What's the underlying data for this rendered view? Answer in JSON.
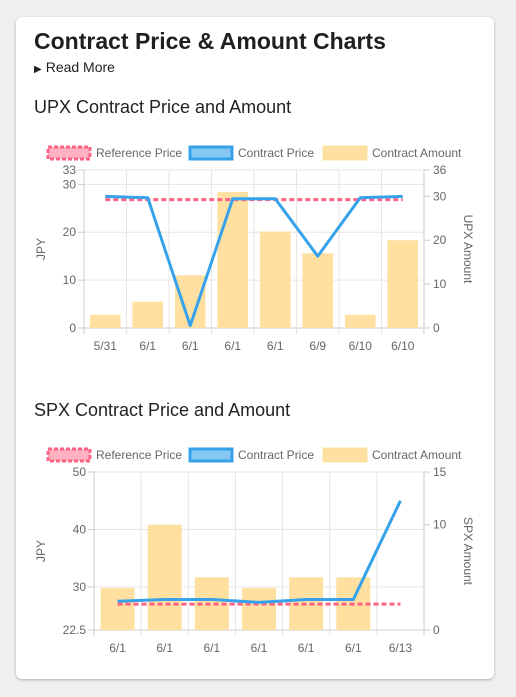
{
  "page": {
    "title": "Contract Price & Amount Charts",
    "read_more": "Read More",
    "read_more_icon": "triangle-right-icon"
  },
  "colors": {
    "reference": "#ff6384",
    "contract_price": "#36a2eb",
    "contract_amount": "#ffe0a0",
    "grid": "#e6e6e6",
    "text": "#666666"
  },
  "chart_data": [
    {
      "type": "bar",
      "title": "UPX Contract Price and Amount",
      "legend": [
        "Reference Price",
        "Contract Price",
        "Contract Amount"
      ],
      "legend_position": "top",
      "categories": [
        "5/31",
        "6/1",
        "6/1",
        "6/1",
        "6/1",
        "6/9",
        "6/10",
        "6/10"
      ],
      "ylabel_left": "JPY",
      "ylabel_right": "UPX Amount",
      "left_ticks": [
        0,
        10,
        20,
        30,
        33
      ],
      "right_ticks": [
        0,
        10,
        20,
        30,
        36
      ],
      "ylim_left": [
        0,
        33
      ],
      "ylim_right": [
        0,
        36
      ],
      "grid": true,
      "series": [
        {
          "name": "Reference Price",
          "kind": "line",
          "axis": "left",
          "values": [
            26.8,
            26.8,
            26.8,
            26.8,
            26.8,
            26.8,
            26.8,
            26.8
          ]
        },
        {
          "name": "Contract Price",
          "kind": "line",
          "axis": "left",
          "values": [
            27.5,
            27.2,
            0.5,
            27,
            27,
            15,
            27.2,
            27.5
          ]
        },
        {
          "name": "Contract Amount",
          "kind": "bar",
          "axis": "right",
          "values": [
            3,
            6,
            12,
            31,
            22,
            17,
            3,
            20
          ]
        }
      ]
    },
    {
      "type": "bar",
      "title": "SPX Contract Price and Amount",
      "legend": [
        "Reference Price",
        "Contract Price",
        "Contract Amount"
      ],
      "legend_position": "top",
      "categories": [
        "6/1",
        "6/1",
        "6/1",
        "6/1",
        "6/1",
        "6/1",
        "6/13"
      ],
      "ylabel_left": "JPY",
      "ylabel_right": "SPX Amount",
      "left_ticks": [
        22.5,
        30,
        40,
        50
      ],
      "right_ticks": [
        0,
        10,
        15
      ],
      "ylim_left": [
        22.5,
        50
      ],
      "ylim_right": [
        0,
        15
      ],
      "grid": true,
      "series": [
        {
          "name": "Reference Price",
          "kind": "line",
          "axis": "left",
          "values": [
            27,
            27,
            27,
            27,
            27,
            27,
            27
          ]
        },
        {
          "name": "Contract Price",
          "kind": "line",
          "axis": "left",
          "values": [
            27.5,
            27.8,
            27.8,
            27.3,
            27.8,
            27.8,
            45
          ]
        },
        {
          "name": "Contract Amount",
          "kind": "bar",
          "axis": "right",
          "values": [
            4,
            10,
            5,
            4,
            5,
            5,
            0
          ]
        }
      ]
    }
  ]
}
